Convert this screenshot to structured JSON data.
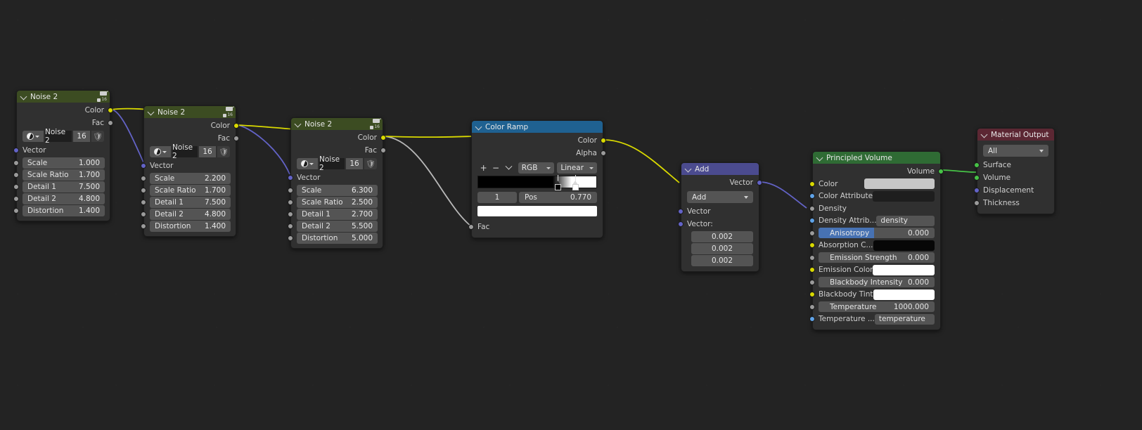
{
  "editor": {
    "background": "#232323"
  },
  "nodes": [
    {
      "id": "noise1",
      "title": "Noise 2",
      "header_color": "#3c4c22",
      "bake_count": "16",
      "outputs": [
        {
          "label": "Color",
          "color": "yellow"
        },
        {
          "label": "Fac",
          "color": "grey"
        }
      ],
      "widget": {
        "name": "Noise 2",
        "count": "16"
      },
      "vector_label": "Vector",
      "props": [
        {
          "label": "Scale",
          "value": "1.000"
        },
        {
          "label": "Scale Ratio",
          "value": "1.700"
        },
        {
          "label": "Detail 1",
          "value": "7.500"
        },
        {
          "label": "Detail 2",
          "value": "4.800"
        },
        {
          "label": "Distortion",
          "value": "1.400"
        }
      ]
    },
    {
      "id": "noise2",
      "title": "Noise 2",
      "header_color": "#3c4c22",
      "bake_count": "16",
      "outputs": [
        {
          "label": "Color",
          "color": "yellow"
        },
        {
          "label": "Fac",
          "color": "grey"
        }
      ],
      "widget": {
        "name": "Noise 2",
        "count": "16"
      },
      "vector_label": "Vector",
      "props": [
        {
          "label": "Scale",
          "value": "2.200"
        },
        {
          "label": "Scale Ratio",
          "value": "1.700"
        },
        {
          "label": "Detail 1",
          "value": "7.500"
        },
        {
          "label": "Detail 2",
          "value": "4.800"
        },
        {
          "label": "Distortion",
          "value": "1.400"
        }
      ]
    },
    {
      "id": "noise3",
      "title": "Noise 2",
      "header_color": "#3c4c22",
      "bake_count": "16",
      "outputs": [
        {
          "label": "Color",
          "color": "yellow"
        },
        {
          "label": "Fac",
          "color": "grey"
        }
      ],
      "widget": {
        "name": "Noise 2",
        "count": "16"
      },
      "vector_label": "Vector",
      "props": [
        {
          "label": "Scale",
          "value": "6.300"
        },
        {
          "label": "Scale Ratio",
          "value": "2.500"
        },
        {
          "label": "Detail 1",
          "value": "2.700"
        },
        {
          "label": "Detail 2",
          "value": "5.500"
        },
        {
          "label": "Distortion",
          "value": "5.000"
        }
      ]
    }
  ],
  "color_ramp": {
    "title": "Color Ramp",
    "header_color": "#1f6191",
    "outputs": [
      {
        "label": "Color",
        "color": "yellow"
      },
      {
        "label": "Alpha",
        "color": "grey"
      }
    ],
    "tools": {
      "add": "+",
      "remove": "−"
    },
    "color_mode": "RGB",
    "interpolation": "Linear",
    "stop_index": "1",
    "pos_label": "Pos",
    "pos_value": "0.770",
    "selected_color": "#ffffff",
    "input_label": "Fac",
    "gradient_start": "#000000",
    "gradient_end": "#ffffff"
  },
  "add_node": {
    "title": "Add",
    "header_color": "#4b4b8f",
    "output_label": "Vector",
    "operation": "Add",
    "input_labels": [
      "Vector",
      "Vector:"
    ],
    "vector_values": [
      "0.002",
      "0.002",
      "0.002"
    ]
  },
  "principled_volume": {
    "title": "Principled Volume",
    "header_color": "#2f6b34",
    "output_label": "Volume",
    "rows": [
      {
        "name": "Color",
        "socket": "yellow",
        "kind": "swatch",
        "value": "#c6c6c6"
      },
      {
        "name": "Color Attribute",
        "socket": "lblue",
        "kind": "text",
        "value": ""
      },
      {
        "name": "Density",
        "socket": "grey",
        "kind": "none",
        "value": ""
      },
      {
        "name": "Density Attrib...",
        "socket": "lblue",
        "kind": "text",
        "value": "density"
      },
      {
        "name": "Anisotropy",
        "socket": "grey",
        "kind": "slider",
        "value": "0.000",
        "selected": true
      },
      {
        "name": "Absorption C...",
        "socket": "yellow",
        "kind": "swatch",
        "value": "#070707"
      },
      {
        "name": "Emission Strength",
        "socket": "grey",
        "kind": "slider",
        "value": "0.000"
      },
      {
        "name": "Emission Color",
        "socket": "yellow",
        "kind": "swatch",
        "value": "#ffffff"
      },
      {
        "name": "Blackbody Intensity",
        "socket": "grey",
        "kind": "slider",
        "value": "0.000"
      },
      {
        "name": "Blackbody Tint",
        "socket": "yellow",
        "kind": "swatch",
        "value": "#ffffff"
      },
      {
        "name": "Temperature",
        "socket": "grey",
        "kind": "slider",
        "value": "1000.000"
      },
      {
        "name": "Temperature ...",
        "socket": "lblue",
        "kind": "text",
        "value": "temperature"
      }
    ]
  },
  "material_output": {
    "title": "Material Output",
    "header_color": "#5c2733",
    "target": "All",
    "inputs": [
      {
        "label": "Surface",
        "color": "green"
      },
      {
        "label": "Volume",
        "color": "green"
      },
      {
        "label": "Displacement",
        "color": "blue"
      },
      {
        "label": "Thickness",
        "color": "grey"
      }
    ]
  }
}
